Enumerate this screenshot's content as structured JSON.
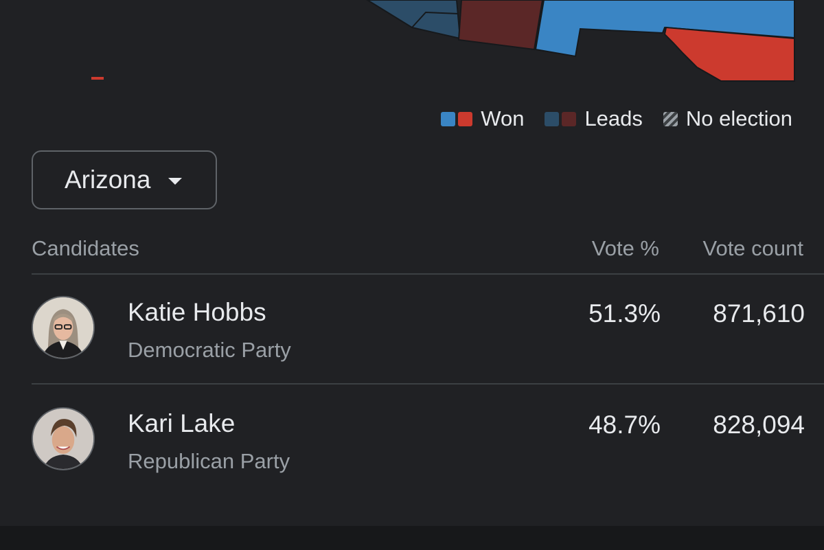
{
  "colors": {
    "dem_won": "#3a85c4",
    "rep_won": "#cc3a2e",
    "dem_leads": "#2c4d68",
    "rep_leads": "#5b2727",
    "background": "#202124"
  },
  "legend": {
    "won_label": "Won",
    "leads_label": "Leads",
    "no_election_label": "No election"
  },
  "state_select": {
    "value": "Arizona",
    "icon": "caret-down-icon"
  },
  "table": {
    "headers": {
      "candidates": "Candidates",
      "vote_pct": "Vote %",
      "vote_count": "Vote count"
    },
    "rows": [
      {
        "name": "Katie Hobbs",
        "party": "Democratic Party",
        "vote_pct": "51.3%",
        "vote_count": "871,610"
      },
      {
        "name": "Kari Lake",
        "party": "Republican Party",
        "vote_pct": "48.7%",
        "vote_count": "828,094"
      }
    ]
  }
}
